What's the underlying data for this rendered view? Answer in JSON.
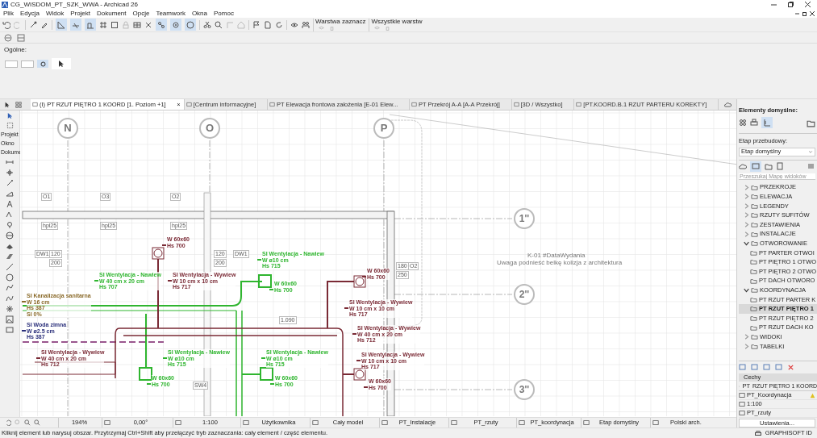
{
  "window": {
    "title": "CG_WISDOM_PT_SZK_WWA - Archicad 26"
  },
  "menu": [
    "Plik",
    "Edycja",
    "Widok",
    "Projekt",
    "Dokument",
    "Opcje",
    "Teamwork",
    "Okna",
    "Pomoc"
  ],
  "layer_groups": [
    {
      "label": "Warstwa zaznacz"
    },
    {
      "label": "Wszystkie warstw"
    }
  ],
  "info_box": {
    "label": "Ogólne:"
  },
  "tabs": [
    {
      "label": "(I) PT RZUT PIĘTRO 1 KOORD [1. Poziom +1]",
      "selected": true,
      "close": "×"
    },
    {
      "label": "[Centrum informacyjne]",
      "selected": false
    },
    {
      "label": "PT Elewacja frontowa założenia [E-01 Elew...",
      "selected": false
    },
    {
      "label": "PT Przekrój A-A [A-A Przekrój]",
      "selected": false
    },
    {
      "label": "[3D / Wszystko]",
      "selected": false
    },
    {
      "label": "[PT.KOORD.B.1 RZUT PARTERU KOREKTY]",
      "selected": false
    }
  ],
  "toolbox": {
    "labels": [
      "Projekt",
      "Okno",
      "Dokume"
    ]
  },
  "drawing": {
    "axes": [
      {
        "label": "N",
        "kind": "column"
      },
      {
        "label": "O",
        "kind": "column"
      },
      {
        "label": "P",
        "kind": "column"
      },
      {
        "label": "1''",
        "kind": "row"
      },
      {
        "label": "2''",
        "kind": "row"
      },
      {
        "label": "3''",
        "kind": "row"
      }
    ],
    "tags": [
      "O1",
      "O3",
      "O2",
      "hpl25",
      "hpl25",
      "hpl25",
      "DW1",
      "120",
      "120",
      "DW1",
      "200",
      "200",
      "180",
      "O2",
      "250",
      "1.090",
      "SW4"
    ],
    "note": {
      "title": "K-01 #DataWydania",
      "text": "Uwaga podnieść belkę kolizja z architektura"
    },
    "annotations": [
      {
        "lines": [
          "W 60x60",
          "Hs 700"
        ],
        "color": "#7a2a35"
      },
      {
        "lines": [
          "SI Wentylacja - Nawiew",
          "W ø10 cm",
          "Hs 715"
        ],
        "color": "#2fb52f"
      },
      {
        "lines": [
          "SI Wentylacja - Nawiew",
          "W 40 cm x 20 cm",
          "Hs 707"
        ],
        "color": "#2fb52f"
      },
      {
        "lines": [
          "SI Wentylacja - Wywiew",
          "W 10 cm x 10 cm",
          "Hs 717"
        ],
        "color": "#7a2a35"
      },
      {
        "lines": [
          "W 60x60",
          "Hs 700"
        ],
        "color": "#2fb52f"
      },
      {
        "lines": [
          "W 60x60",
          "Hs 700"
        ],
        "color": "#7a2a35"
      },
      {
        "lines": [
          "SI Kanalizacja sanitarna",
          "W 16 cm",
          "Hs 387",
          "Sl 0%"
        ],
        "color": "#8a6a2a"
      },
      {
        "lines": [
          "SI Wentylacja - Wywiew",
          "W 10 cm x 10 cm",
          "Hs 717"
        ],
        "color": "#7a2a35"
      },
      {
        "lines": [
          "SI Woda zimna",
          "W ø2.5 cm",
          "Hs 387"
        ],
        "color": "#2a2f7a"
      },
      {
        "lines": [
          "SI Wentylacja - Wywiew",
          "W 40 cm x 20 cm",
          "Hs 712"
        ],
        "color": "#7a2a35"
      },
      {
        "lines": [
          "SI Wentylacja - Wywiew",
          "W 40 cm x 20 cm",
          "Hs 712"
        ],
        "color": "#7a2a35"
      },
      {
        "lines": [
          "SI Wentylacja - Nawiew",
          "W ø10 cm",
          "Hs 715"
        ],
        "color": "#2fb52f"
      },
      {
        "lines": [
          "SI Wentylacja - Nawiew",
          "W ø10 cm",
          "Hs 715"
        ],
        "color": "#2fb52f"
      },
      {
        "lines": [
          "SI Wentylacja - Wywiew",
          "W 10 cm x 10 cm",
          "Hs 717"
        ],
        "color": "#7a2a35"
      },
      {
        "lines": [
          "W 60x60",
          "Hs 700"
        ],
        "color": "#2fb52f"
      },
      {
        "lines": [
          "W 60x60",
          "Hs 700"
        ],
        "color": "#2fb52f"
      },
      {
        "lines": [
          "W 60x60",
          "Hs 700"
        ],
        "color": "#7a2a35"
      }
    ]
  },
  "right_panel": {
    "defaults_label": "Elementy domyślne:",
    "phase_label": "Etap przebudowy:",
    "phase_value": "Etap domyślny",
    "search": {
      "placeholder": "Przeszukaj Mapę widoków"
    },
    "tree": [
      {
        "label": "PRZEKROJE",
        "expanded": false
      },
      {
        "label": "ELEWACJA",
        "expanded": false
      },
      {
        "label": "LEGENDY",
        "expanded": false
      },
      {
        "label": "RZUTY SUFITÓW",
        "expanded": false
      },
      {
        "label": "ZESTAWIENIA",
        "expanded": false
      },
      {
        "label": "INSTALACJE",
        "expanded": false
      },
      {
        "label": "OTWOROWANIE",
        "expanded": true,
        "children": [
          {
            "label": "PT PARTER OTWOI",
            "selected": false
          },
          {
            "label": "PT PIĘTRO 1 OTWO",
            "selected": false
          },
          {
            "label": "PT PIĘTRO 2 OTWO",
            "selected": false
          },
          {
            "label": "PT DACH OTWORO",
            "selected": false
          }
        ]
      },
      {
        "label": "KOORDYNACJA",
        "expanded": true,
        "children": [
          {
            "label": "PT RZUT PARTER K",
            "selected": false
          },
          {
            "label": "PT RZUT PIĘTRO 1",
            "selected": true
          },
          {
            "label": "PT RZUT PIĘTRO 2",
            "selected": false
          },
          {
            "label": "PT RZUT DACH KO",
            "selected": false
          }
        ]
      },
      {
        "label": "WIDOKI",
        "expanded": false
      },
      {
        "label": "TABELKI",
        "expanded": false
      }
    ],
    "properties": {
      "title": "Cechy",
      "id": "PT",
      "name": "RZUT PIĘTRO 1 KOORD",
      "layer_combo": "PT_Koordynacja",
      "scale": "1:100",
      "view": "PT_rzuty",
      "button": "Ustawienia..."
    }
  },
  "status_bar": {
    "zoom": "194%",
    "angle": "0,00°",
    "items": [
      "1:100",
      "Użytkownika",
      "Cały model",
      "PT_Instalacje",
      "PT_rzuty",
      "PT_koordynacja",
      "Etap domyślny",
      "Polski arch."
    ]
  },
  "message": "Kliknij element lub narysuj obszar. Przytrzymaj Ctrl+Shift aby przełączyć tryb zaznaczania: cały element / część elementu.",
  "account": "GRAPHISOFT ID"
}
